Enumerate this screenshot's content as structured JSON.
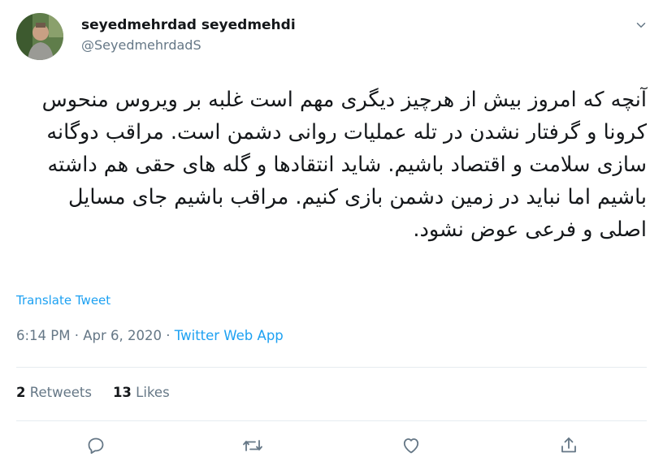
{
  "author": {
    "display_name": "seyedmehrdad seyedmehdi",
    "handle": "@SeyedmehrdadS"
  },
  "tweet": {
    "text": "آنچه که امروز بیش از هرچیز دیگری مهم است غلبه بر ویروس منحوس کرونا و گرفتار نشدن در تله عملیات روانی دشمن است. مراقب دوگانه سازی سلامت و اقتصاد باشیم. شاید انتقادها و گله های حقی هم داشته باشیم اما نباید در زمین دشمن بازی کنیم. مراقب باشیم جای مسایل اصلی و فرعی عوض نشود.",
    "translate_label": "Translate Tweet",
    "time": "6:14 PM",
    "separator": "·",
    "date": "Apr 6, 2020",
    "source": "Twitter Web App"
  },
  "stats": {
    "retweets_count": "2",
    "retweets_label": "Retweets",
    "likes_count": "13",
    "likes_label": "Likes"
  },
  "icons": {
    "caret": "chevron-down-icon",
    "reply": "reply-icon",
    "retweet": "retweet-icon",
    "like": "heart-icon",
    "share": "share-icon"
  },
  "colors": {
    "accent": "#1da1f2",
    "secondary_text": "#657786",
    "primary_text": "#14171a",
    "divider": "#e6ecf0"
  }
}
